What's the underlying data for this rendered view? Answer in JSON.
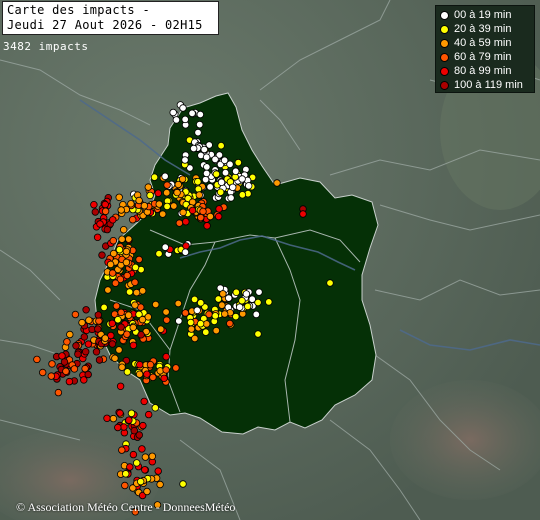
{
  "title": {
    "line1": "Carte des impacts -",
    "line2": "Jeudi 27 Aout 2026 - 02H15"
  },
  "impact_count": "3482 impacts",
  "legend": [
    {
      "label": "00 à 19 min",
      "color": "#ffffff"
    },
    {
      "label": "20 à 39 min",
      "color": "#ffff00"
    },
    {
      "label": "40 à 59 min",
      "color": "#ff9900"
    },
    {
      "label": "60 à 79 min",
      "color": "#ff5500"
    },
    {
      "label": "80 à 99 min",
      "color": "#ee0000"
    },
    {
      "label": "100 à 119 min",
      "color": "#aa0000"
    }
  ],
  "credit": "© Association Météo Centre - DonneesMétéo",
  "colors": {
    "terrain": "#5b6a5d",
    "region_fill": "#053006",
    "boundary_line": "#9aa6a0",
    "river": "#4e6a8c"
  }
}
